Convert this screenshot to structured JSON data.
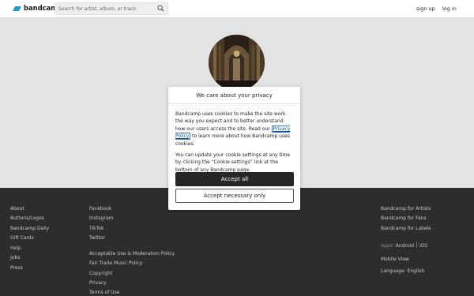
{
  "header": {
    "logo_text": "bandcamp",
    "search_placeholder": "Search for artist, album, or track",
    "signup_label": "sign up",
    "login_label": "log in"
  },
  "footer": {
    "col1": [
      "About",
      "Buttons/Logos",
      "Bandcamp Daily",
      "Gift Cards",
      "Help",
      "Jobs",
      "Press"
    ],
    "col2a": [
      "Facebook",
      "Instagram",
      "TikTok",
      "Twitter"
    ],
    "col2b": [
      "Acceptable Use & Moderation Policy",
      "Fair Trade Music Policy",
      "Copyright",
      "Privacy",
      "Terms of Use"
    ],
    "col3": [
      "Bandcamp for Artists",
      "Bandcamp for Fans",
      "Bandcamp for Labels"
    ],
    "apps_label": "Apps:",
    "apps": [
      "Android",
      "iOS"
    ],
    "mobile_view": "Mobile View",
    "language": "Language: English"
  },
  "dialog": {
    "title": "We care about your privacy",
    "para1_before": "Bandcamp uses cookies to make the site work the way you expect and to better understand how our users access the site. Read our ",
    "privacy_link": "Privacy Policy",
    "para1_after": " to learn more about how Bandcamp uses cookies.",
    "para2": "You can update your cookie settings at any time by clicking the “Cookie settings” link at the bottom of any Bandcamp page.",
    "accept_all": "Accept all",
    "accept_necessary": "Accept necessary only"
  },
  "colors": {
    "logo_accent": "#1da0c3",
    "footer_bg": "#2d2d2d",
    "primary_button": "#262626"
  }
}
